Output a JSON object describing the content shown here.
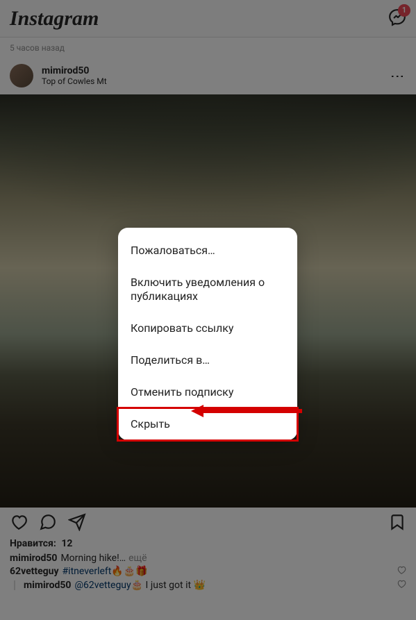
{
  "header": {
    "logo": "Instagram",
    "badge_count": "1"
  },
  "timestamp": "5 часов назад",
  "post": {
    "username": "mimirod50",
    "location": "Top of Cowles Mt"
  },
  "likes": {
    "label": "Нравится:",
    "count": "12"
  },
  "caption": {
    "author": "mimirod50",
    "text": "Morning hike!",
    "ellipsis": "…",
    "more": "ещё"
  },
  "comments": [
    {
      "author": "62vetteguy",
      "hashtag": "#itneverleft",
      "emoji": " 🔥🎂🎁"
    },
    {
      "author": "mimirod50",
      "mention": "@62vetteguy",
      "text": " 🎂 I just got it 👑"
    }
  ],
  "modal": {
    "items": [
      "Пожаловаться…",
      "Включить уведомления о публикациях",
      "Копировать ссылку",
      "Поделиться в…",
      "Отменить подписку",
      "Скрыть"
    ]
  },
  "icons": {
    "messenger": "messenger-icon",
    "more": "more-icon",
    "like": "heart-icon",
    "comment": "comment-icon",
    "share": "share-icon",
    "save": "bookmark-icon",
    "small_heart": "heart-outline-icon"
  }
}
